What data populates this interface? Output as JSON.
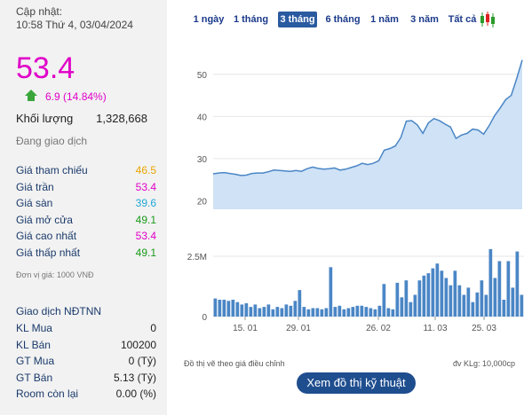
{
  "left": {
    "updated_label": "Cập nhật:",
    "updated_time": "10:58 Thứ 4, 03/04/2024",
    "price": "53.4",
    "change": "6.9 (14.84%)",
    "volume_label": "Khối lượng",
    "volume_value": "1,328,668",
    "status": "Đang giao dịch",
    "rows": [
      {
        "label": "Giá tham chiếu",
        "value": "46.5",
        "color": "#e8a500"
      },
      {
        "label": "Giá trần",
        "value": "53.4",
        "color": "#e000c8"
      },
      {
        "label": "Giá sàn",
        "value": "39.6",
        "color": "#1fa8d8"
      },
      {
        "label": "Giá mở cửa",
        "value": "49.1",
        "color": "#1a9a1a"
      },
      {
        "label": "Giá cao nhất",
        "value": "53.4",
        "color": "#e000c8"
      },
      {
        "label": "Giá thấp nhất",
        "value": "49.1",
        "color": "#1a9a1a"
      }
    ],
    "unit_note": "Đơn vị giá: 1000 VNĐ",
    "foreign_title": "Giao dịch NĐTNN",
    "foreign_rows": [
      {
        "label": "KL Mua",
        "value": "0"
      },
      {
        "label": "KL Bán",
        "value": "100200"
      },
      {
        "label": "GT Mua",
        "value": "0 (Tỷ)"
      },
      {
        "label": "GT Bán",
        "value": "5.13 (Tỷ)"
      },
      {
        "label": "Room còn lại",
        "value": "0.00 (%)"
      }
    ],
    "colors": {
      "price": "#e000c8",
      "change": "#e000c8",
      "up_arrow": "#3aa63a"
    }
  },
  "tabs": [
    {
      "label": "1 ngày",
      "active": false
    },
    {
      "label": "1 tháng",
      "active": false
    },
    {
      "label": "3 tháng",
      "active": true
    },
    {
      "label": "6 tháng",
      "active": false
    },
    {
      "label": "1 năm",
      "active": false
    },
    {
      "label": "3 năm",
      "active": false
    },
    {
      "label": "Tất cả",
      "active": false
    }
  ],
  "candle_icon": "candlestick-icon",
  "footer": {
    "adjusted_note": "Đồ thị vẽ theo giá điều chỉnh",
    "volume_unit": "đv KLg: 10,000cp",
    "tech_button": "Xem đồ thị kỹ thuật"
  },
  "chart_data": [
    {
      "type": "area",
      "series": [
        {
          "values": [
            26.4,
            26.6,
            26.7,
            26.5,
            26.3,
            26.0,
            26.1,
            26.5,
            26.6,
            26.6,
            26.9,
            27.3,
            27.2,
            27.1,
            27.0,
            27.2,
            27.0,
            27.6,
            28.0,
            27.7,
            27.5,
            27.6,
            27.8,
            27.3,
            27.5,
            27.9,
            28.3,
            28.9,
            28.6,
            28.9,
            29.5,
            32.0,
            32.4,
            33.0,
            35.0,
            38.9,
            39.0,
            38.0,
            36.0,
            38.5,
            39.5,
            39.0,
            38.2,
            37.5,
            34.8,
            35.6,
            36.0,
            37.0,
            36.8,
            35.8,
            37.8,
            40.2,
            42.0,
            44.0,
            45.0,
            49.0,
            53.4
          ]
        }
      ],
      "yticks": [
        "20",
        "30",
        "40",
        "50"
      ],
      "ylim": [
        18,
        55
      ],
      "color": "#5b9bd5"
    },
    {
      "type": "bar",
      "series": [
        {
          "values": [
            0.75,
            0.7,
            0.7,
            0.65,
            0.7,
            0.6,
            0.5,
            0.55,
            0.4,
            0.5,
            0.35,
            0.4,
            0.5,
            0.3,
            0.4,
            0.35,
            0.5,
            0.45,
            0.65,
            1.1,
            0.4,
            0.3,
            0.35,
            0.35,
            0.3,
            0.35,
            2.05,
            0.4,
            0.45,
            0.3,
            0.35,
            0.4,
            0.45,
            0.45,
            0.4,
            0.35,
            0.3,
            0.45,
            1.35,
            0.35,
            0.3,
            1.4,
            0.8,
            1.5,
            0.6,
            0.9,
            1.5,
            1.7,
            1.8,
            2.0,
            2.2,
            1.9,
            1.6,
            1.3,
            1.9,
            1.3,
            0.9,
            1.2,
            0.6,
            1.0,
            1.5,
            0.9,
            2.8,
            1.6,
            2.3,
            0.7,
            2.3,
            1.2,
            2.7,
            0.9
          ]
        }
      ],
      "yticks": [
        "0",
        "2.5M"
      ],
      "xticks": [
        "15. 01",
        "29. 01",
        "26. 02",
        "11. 03",
        "25. 03"
      ],
      "color": "#4a86c5"
    }
  ]
}
